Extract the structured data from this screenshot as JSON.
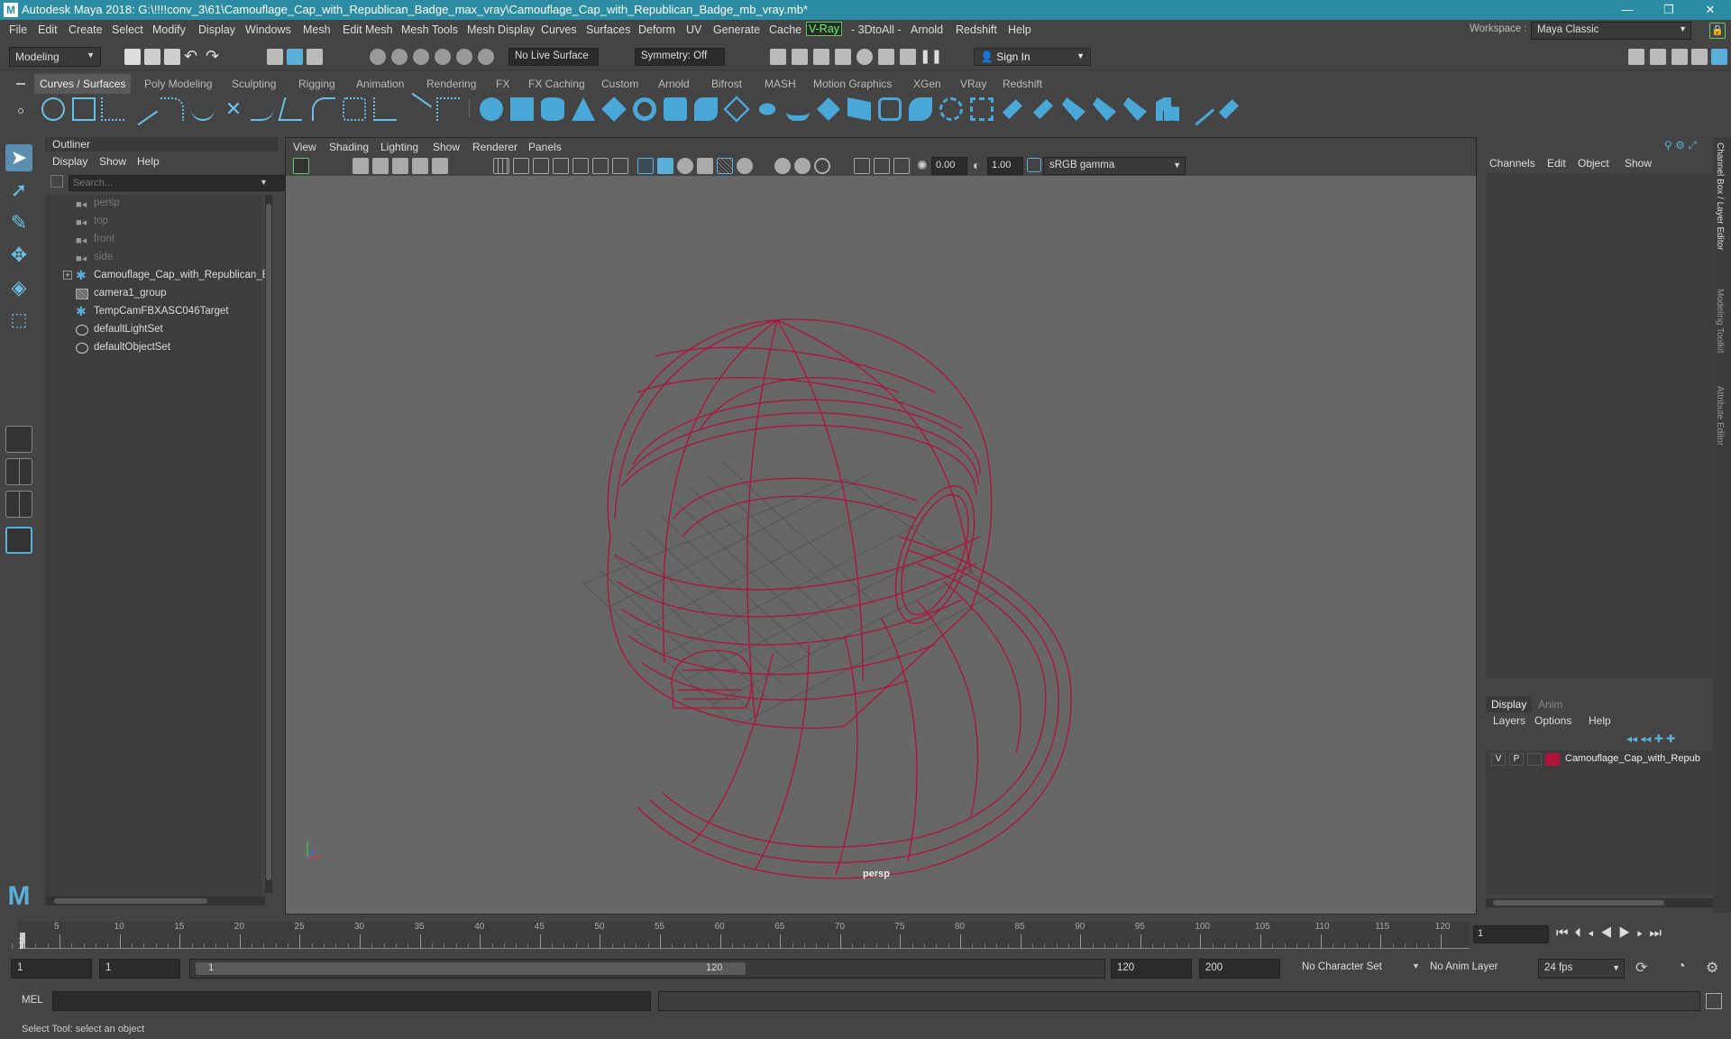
{
  "window": {
    "title": "Autodesk Maya 2018: G:\\!!!!conv_3\\61\\Camouflage_Cap_with_Republican_Badge_max_vray\\Camouflage_Cap_with_Republican_Badge_mb_vray.mb*",
    "logo": "M",
    "minimize": "—",
    "maximize": "❐",
    "close": "✕"
  },
  "menubar": {
    "items": [
      "File",
      "Edit",
      "Create",
      "Select",
      "Modify",
      "Display",
      "Windows",
      "Mesh",
      "Edit Mesh",
      "Mesh Tools",
      "Mesh Display",
      "Curves",
      "Surfaces",
      "Deform",
      "UV",
      "Generate",
      "Cache",
      "V-Ray",
      "- 3DtoAll -",
      "Arnold",
      "Redshift",
      "Help"
    ],
    "workspace_label": "Workspace :",
    "workspace_value": "Maya Classic"
  },
  "toolbar": {
    "mode": "Modeling",
    "live_surface": "No Live Surface",
    "symmetry": "Symmetry: Off",
    "sign_in": "Sign In"
  },
  "shelf": {
    "tabs": [
      "Curves / Surfaces",
      "Poly Modeling",
      "Sculpting",
      "Rigging",
      "Animation",
      "Rendering",
      "FX",
      "FX Caching",
      "Custom",
      "Arnold",
      "Bifrost",
      "MASH",
      "Motion Graphics",
      "XGen",
      "VRay",
      "Redshift"
    ],
    "active": "Curves / Surfaces"
  },
  "outliner": {
    "title": "Outliner",
    "menu": [
      "Display",
      "Show",
      "Help"
    ],
    "search_placeholder": "Search...",
    "items": [
      {
        "label": "persp",
        "icon": "camera-icon",
        "dim": true
      },
      {
        "label": "top",
        "icon": "camera-icon",
        "dim": true
      },
      {
        "label": "front",
        "icon": "camera-icon",
        "dim": true
      },
      {
        "label": "side",
        "icon": "camera-icon",
        "dim": true
      },
      {
        "label": "Camouflage_Cap_with_Republican_B",
        "icon": "transform-icon",
        "dim": false,
        "expand": true
      },
      {
        "label": "camera1_group",
        "icon": "group-icon",
        "dim": false
      },
      {
        "label": "TempCamFBXASC046Target",
        "icon": "transform-icon",
        "dim": false
      },
      {
        "label": "defaultLightSet",
        "icon": "set-icon",
        "dim": false
      },
      {
        "label": "defaultObjectSet",
        "icon": "set-icon",
        "dim": false
      }
    ]
  },
  "viewport": {
    "menu": [
      "View",
      "Shading",
      "Lighting",
      "Show",
      "Renderer",
      "Panels"
    ],
    "exposure": "0.00",
    "gamma": "1.00",
    "color_space": "sRGB gamma",
    "camera_label": "persp",
    "wire_color": "#b0123a"
  },
  "channelbox": {
    "menu": [
      "Channels",
      "Edit",
      "Object",
      "Show"
    ],
    "side_tabs": [
      "Channel Box / Layer Editor",
      "Modeling Toolkit",
      "Attribute Editor"
    ],
    "layer_tabs": [
      "Display",
      "Anim"
    ],
    "layer_menu": [
      "Layers",
      "Options",
      "Help"
    ],
    "layer": {
      "v": "V",
      "p": "P",
      "name": "Camouflage_Cap_with_Repub",
      "color": "#b0123a"
    }
  },
  "timeline": {
    "ticks": [
      "5",
      "10",
      "15",
      "20",
      "25",
      "30",
      "35",
      "40",
      "45",
      "50",
      "55",
      "60",
      "65",
      "70",
      "75",
      "80",
      "85",
      "90",
      "95",
      "100",
      "105",
      "110",
      "115",
      "120"
    ],
    "current_frame": "1",
    "frame_field": "1"
  },
  "range": {
    "start": "1",
    "anim_start": "1",
    "slider_start": "1",
    "slider_end": "120",
    "end": "120",
    "anim_end": "200",
    "character_set": "No Character Set",
    "anim_layer": "No Anim Layer",
    "fps": "24 fps"
  },
  "cmdline": {
    "label": "MEL"
  },
  "helpline": {
    "text": "Select Tool: select an object"
  }
}
